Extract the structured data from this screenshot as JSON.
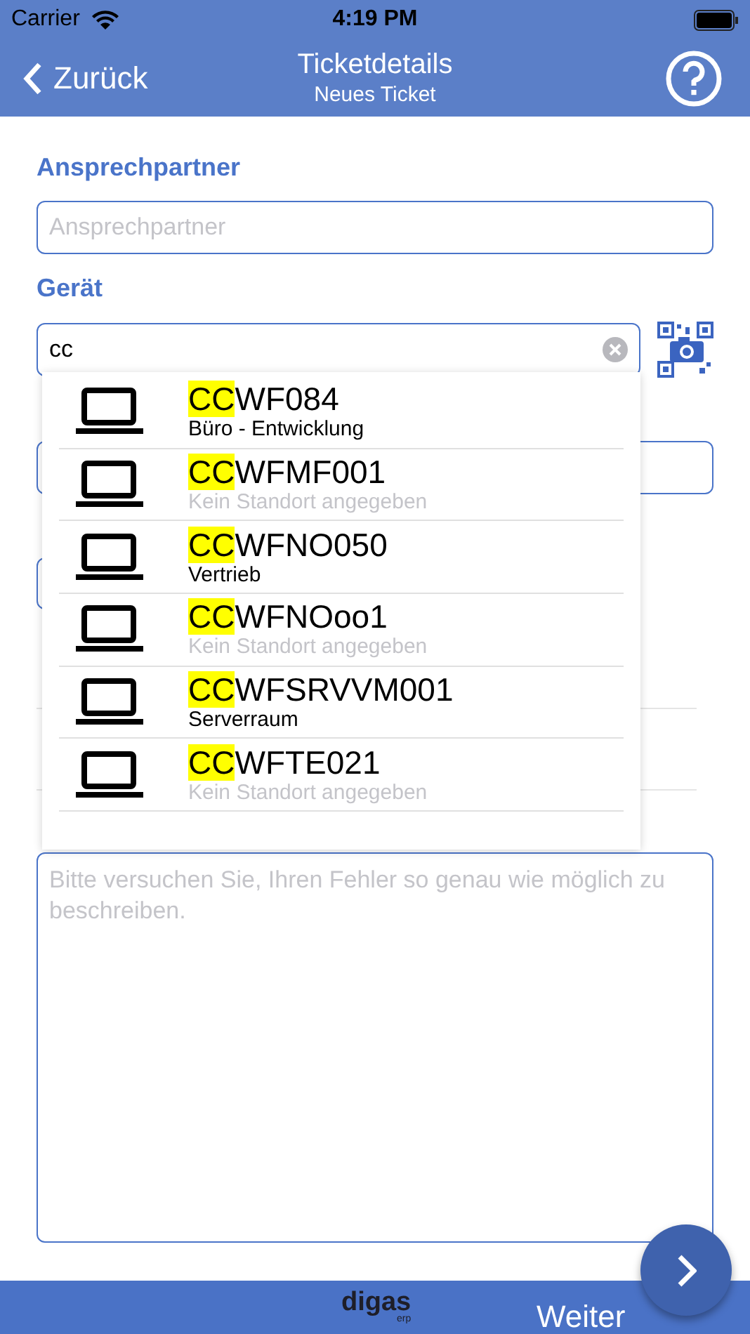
{
  "status_bar": {
    "carrier": "Carrier",
    "time": "4:19 PM"
  },
  "nav": {
    "back": "Zurück",
    "title": "Ticketdetails",
    "subtitle": "Neues Ticket"
  },
  "form": {
    "contact_label": "Ansprechpartner",
    "contact_placeholder": "Ansprechpartner",
    "device_label": "Gerät",
    "device_value": "cc",
    "description_placeholder": "Bitte versuchen Sie, Ihren Fehler so genau wie möglich zu beschreiben."
  },
  "suggestions": [
    {
      "match": "CC",
      "rest": "WF084",
      "location": "Büro - Entwicklung",
      "has_location": true
    },
    {
      "match": "CC",
      "rest": "WFMF001",
      "location": "Kein Standort angegeben",
      "has_location": false
    },
    {
      "match": "CC",
      "rest": "WFNO050",
      "location": "Vertrieb",
      "has_location": true
    },
    {
      "match": "CC",
      "rest": "WFNOoo1",
      "location": "Kein Standort angegeben",
      "has_location": false
    },
    {
      "match": "CC",
      "rest": "WFSRVVM001",
      "location": "Serverraum",
      "has_location": true
    },
    {
      "match": "CC",
      "rest": "WFTE021",
      "location": "Kein Standort angegeben",
      "has_location": false
    }
  ],
  "footer": {
    "logo": "digas",
    "logo_sub": "erp",
    "next": "Weiter"
  }
}
